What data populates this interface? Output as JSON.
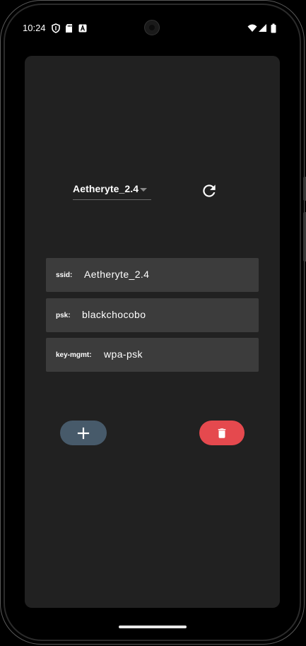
{
  "status_bar": {
    "time": "10:24",
    "icons_left": [
      "shield-icon",
      "sd-card-icon",
      "a-notification-icon"
    ],
    "icons_right": [
      "wifi-icon",
      "signal-icon",
      "battery-icon"
    ]
  },
  "network_selector": {
    "selected": "Aetheryte_2.4"
  },
  "fields": [
    {
      "label": "ssid:",
      "value": "Aetheryte_2.4"
    },
    {
      "label": "psk:",
      "value": "blackchocobo"
    },
    {
      "label": "key-mgmt:",
      "value": "wpa-psk"
    }
  ],
  "buttons": {
    "add_icon": "plus-icon",
    "delete_icon": "trash-icon",
    "refresh_icon": "refresh-icon"
  },
  "colors": {
    "card_bg": "#212121",
    "field_bg": "#3c3c3c",
    "add_button": "#475a6a",
    "delete_button": "#e5494e"
  }
}
